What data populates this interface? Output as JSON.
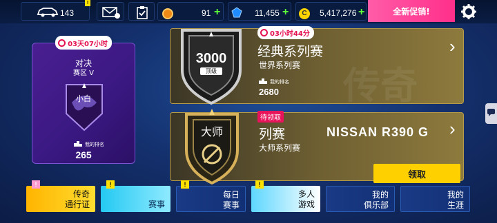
{
  "topbar": {
    "cars_count": "143",
    "tokens": "91",
    "credits": "11,455",
    "gold": "5,417,276",
    "promo_label": "全新促销!",
    "plus": "+"
  },
  "duel": {
    "timer": "03天07小时",
    "title": "对决",
    "region": "赛区 V",
    "emblem_text": "小白",
    "rank_label": "我的排名",
    "rank_value": "265"
  },
  "classic": {
    "timer": "03小时44分",
    "badge_number": "3000",
    "badge_level": "顶级",
    "title": "经典系列赛",
    "subtitle": "世界系列赛",
    "rank_label": "我的排名",
    "rank_value": "2680",
    "watermark": "传奇"
  },
  "master": {
    "tag": "待领取",
    "badge_text": "大师",
    "title": "列赛",
    "subtitle": "大师系列赛",
    "car_name": "NISSAN R390 G",
    "claim_button": "领取"
  },
  "nav": [
    {
      "line1": "传奇",
      "line2": "通行证"
    },
    {
      "line1": "",
      "line2": "赛事"
    },
    {
      "line1": "每日",
      "line2": "赛事"
    },
    {
      "line1": "多人",
      "line2": "游戏"
    },
    {
      "line1": "我的",
      "line2": "俱乐部"
    },
    {
      "line1": "我的",
      "line2": "生涯"
    }
  ],
  "badge_mark": "!",
  "chevron": "›",
  "icons": [
    "car-icon",
    "mail-icon",
    "clipboard-icon",
    "token-icon",
    "credits-icon",
    "gold-coin-icon",
    "gear-icon",
    "clock-icon",
    "podium-icon"
  ],
  "colors": {
    "accent_pink": "#ff2f8a",
    "gold": "#ffd000",
    "plus_green": "#5dff3a",
    "timer_red": "#e5104f",
    "purple_card": "#4a1f91"
  }
}
